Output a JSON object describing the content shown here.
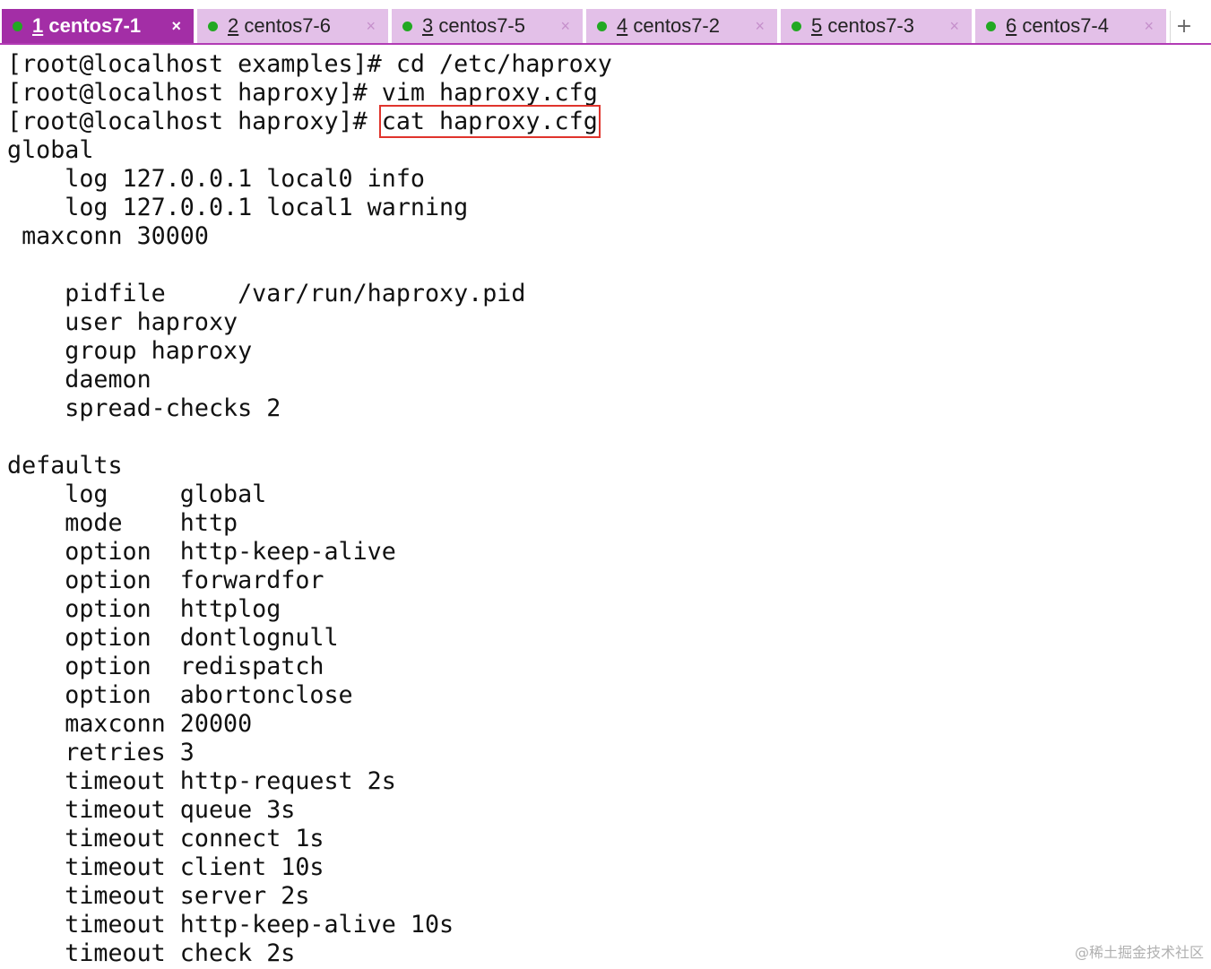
{
  "tabs": [
    {
      "num": "1",
      "name": "centos7-1",
      "active": true
    },
    {
      "num": "2",
      "name": "centos7-6",
      "active": false
    },
    {
      "num": "3",
      "name": "centos7-5",
      "active": false
    },
    {
      "num": "4",
      "name": "centos7-2",
      "active": false
    },
    {
      "num": "5",
      "name": "centos7-3",
      "active": false
    },
    {
      "num": "6",
      "name": "centos7-4",
      "active": false
    }
  ],
  "tab_close_glyph": "×",
  "new_tab_glyph": "+",
  "colors": {
    "active_tab": "#a32ea6",
    "inactive_tab": "#e3c0e8",
    "status_dot": "#22a822",
    "highlight_box": "#e0342c"
  },
  "terminal": {
    "prompt_lines": [
      {
        "prompt": "[root@localhost examples]# ",
        "command": "cd /etc/haproxy"
      },
      {
        "prompt": "[root@localhost haproxy]# ",
        "command": "vim haproxy.cfg"
      },
      {
        "prompt": "[root@localhost haproxy]# ",
        "command": "cat haproxy.cfg"
      }
    ],
    "output_lines": [
      "global",
      "    log 127.0.0.1 local0 info",
      "    log 127.0.0.1 local1 warning",
      " maxconn 30000",
      "",
      "    pidfile     /var/run/haproxy.pid",
      "    user haproxy",
      "    group haproxy",
      "    daemon",
      "    spread-checks 2",
      "",
      "defaults",
      "    log     global",
      "    mode    http",
      "    option  http-keep-alive",
      "    option  forwardfor",
      "    option  httplog",
      "    option  dontlognull",
      "    option  redispatch",
      "    option  abortonclose",
      "    maxconn 20000",
      "    retries 3",
      "    timeout http-request 2s",
      "    timeout queue 3s",
      "    timeout connect 1s",
      "    timeout client 10s",
      "    timeout server 2s",
      "    timeout http-keep-alive 10s",
      "    timeout check 2s"
    ]
  },
  "watermark": "@稀土掘金技术社区"
}
